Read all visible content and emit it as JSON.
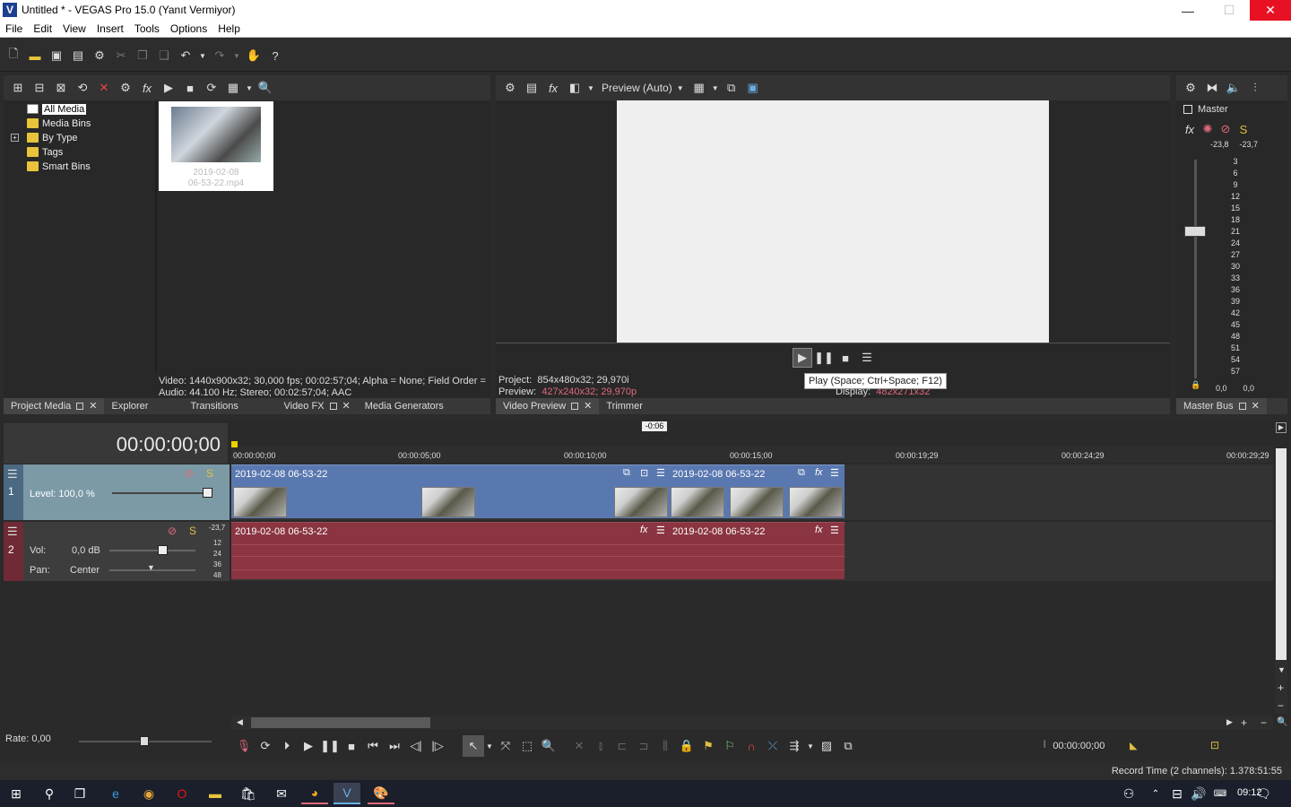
{
  "window": {
    "title": "Untitled * - VEGAS Pro 15.0 (Yanıt Vermiyor)",
    "logo": "V",
    "min": "—",
    "max": "☐",
    "close": "✕"
  },
  "menu": [
    "File",
    "Edit",
    "View",
    "Insert",
    "Tools",
    "Options",
    "Help"
  ],
  "project_media": {
    "tree": [
      "All Media",
      "Media Bins",
      "By Type",
      "Tags",
      "Smart Bins"
    ],
    "thumb_caption_1": "2019-02-08",
    "thumb_caption_2": "06-53-22.mp4",
    "info_video": "Video: 1440x900x32; 30,000 fps; 00:02:57;04; Alpha = None; Field Order =",
    "info_audio": "Audio: 44.100 Hz; Stereo; 00:02:57;04; AAC"
  },
  "tabs_left": [
    {
      "label": "Project Media",
      "active": true
    },
    {
      "label": "Explorer"
    },
    {
      "label": "Transitions"
    },
    {
      "label": "Video FX"
    },
    {
      "label": "Media Generators"
    }
  ],
  "preview": {
    "mode": "Preview (Auto)",
    "project_label": "Project:",
    "project_val": "854x480x32; 29,970i",
    "preview_label": "Preview:",
    "preview_val": "427x240x32; 29,970p",
    "display_label": "Display:",
    "display_val": "482x271x32",
    "tooltip": "Play (Space; Ctrl+Space; F12)"
  },
  "tabs_preview": [
    {
      "label": "Video Preview",
      "active": true
    },
    {
      "label": "Trimmer"
    }
  ],
  "master": {
    "label": "Master",
    "peak_l": "-23,8",
    "peak_r": "-23,7",
    "ticks": [
      "3",
      "6",
      "9",
      "12",
      "15",
      "18",
      "21",
      "24",
      "27",
      "30",
      "33",
      "36",
      "39",
      "42",
      "45",
      "48",
      "51",
      "54",
      "57"
    ],
    "val_l": "0,0",
    "val_r": "0,0",
    "tab": "Master Bus"
  },
  "timeline": {
    "timecode": "00:00:00;00",
    "marker": "-0:06",
    "ruler": [
      "00:00:00;00",
      "00:00:05;00",
      "00:00:10;00",
      "00:00:15;00",
      "00:00:19;29",
      "00:00:24;29",
      "00:00:29;29"
    ],
    "track1": {
      "num": "1",
      "level_label": "Level: 100,0 %"
    },
    "track2": {
      "num": "2",
      "vol_label": "Vol:",
      "vol_val": "0,0 dB",
      "pan_label": "Pan:",
      "pan_val": "Center",
      "peak": "-23,7",
      "scale": [
        "12",
        "24",
        "36",
        "48"
      ]
    },
    "clip_name": "2019-02-08 06-53-22",
    "rate": "Rate: 0,00",
    "cursor_time": "00:00:00;00"
  },
  "status": {
    "record": "Record Time (2 channels): 1.378:51:55"
  },
  "taskbar": {
    "time": "09:12"
  }
}
